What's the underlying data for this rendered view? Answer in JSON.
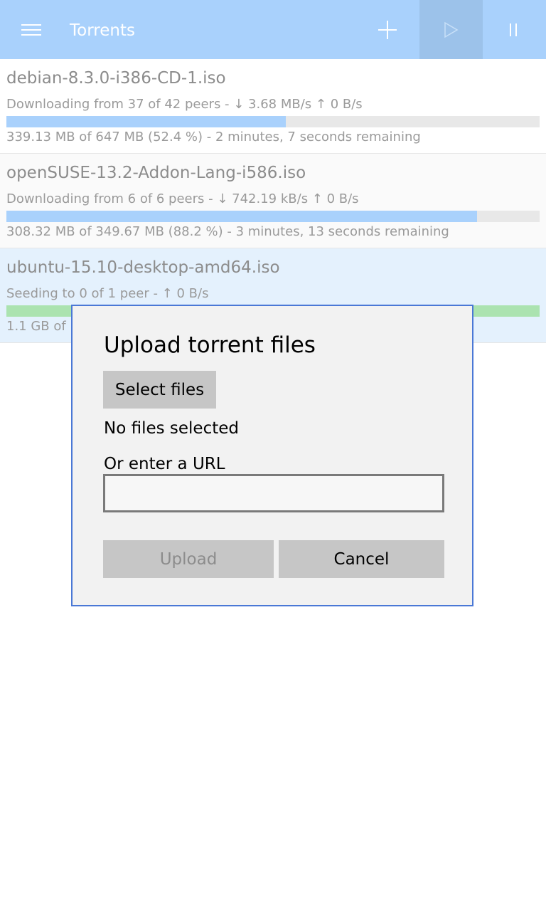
{
  "header": {
    "title": "Torrents",
    "colors": {
      "background": "#a9d1fc",
      "active_button": "#9cc2ea"
    },
    "buttons": [
      {
        "icon": "plus-icon",
        "label": ""
      },
      {
        "icon": "play-icon",
        "label": ""
      },
      {
        "icon": "pause-icon",
        "label": ""
      }
    ]
  },
  "torrents": [
    {
      "name": "debian-8.3.0-i386-CD-1.iso",
      "status": "Downloading from 37 of 42 peers - ↓ 3.68 MB/s ↑ 0 B/s",
      "progress_percent": 52.4,
      "info": "339.13 MB of 647 MB (52.4 %) - 2 minutes, 7 seconds remaining",
      "bar_color": "#a9d1fc"
    },
    {
      "name": "openSUSE-13.2-Addon-Lang-i586.iso",
      "status": "Downloading from 6 of 6 peers - ↓ 742.19 kB/s ↑ 0 B/s",
      "progress_percent": 88.2,
      "info": "308.32 MB of 349.67 MB (88.2 %) - 3 minutes, 13 seconds remaining",
      "bar_color": "#a9d1fc"
    },
    {
      "name": "ubuntu-15.10-desktop-amd64.iso",
      "status": "Seeding to 0 of 1 peer - ↑ 0 B/s",
      "progress_percent": 100,
      "info": "1.1 GB of",
      "bar_color": "#abe3b0"
    }
  ],
  "dialog": {
    "title": "Upload torrent files",
    "select_files_label": "Select files",
    "no_files_text": "No files selected",
    "url_label": "Or enter a URL",
    "url_value": "",
    "upload_label": "Upload",
    "cancel_label": "Cancel",
    "border_color": "#4a78d6"
  }
}
